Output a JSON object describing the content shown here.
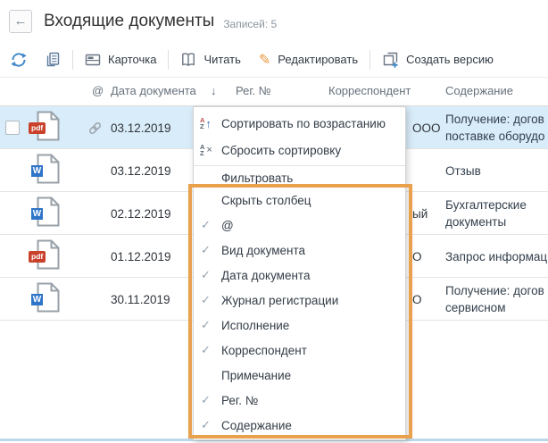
{
  "header": {
    "title": "Входящие документы",
    "records": "Записей: 5"
  },
  "icons": {
    "back": "←",
    "sort_arrow_down": "↓",
    "sort_arrow_up": "↑",
    "clear_x": "×",
    "check": "✓",
    "pencil": "✎",
    "az": {
      "a": "A",
      "z": "Z"
    }
  },
  "toolbar": {
    "card": "Карточка",
    "read": "Читать",
    "edit": "Редактировать",
    "create_version": "Создать версию"
  },
  "table": {
    "header": {
      "at": "@",
      "date": "Дата документа",
      "reg": "Рег. №",
      "correspondent": "Корреспондент",
      "content": "Содержание"
    },
    "rows": [
      {
        "badge": "pdf",
        "date": "03.12.2019",
        "correspondent_fragment": "ООО",
        "content": "Получение: догов\nпоставке оборудо"
      },
      {
        "badge": "W",
        "date": "03.12.2019",
        "correspondent_fragment": "",
        "content": "Отзыв"
      },
      {
        "badge": "W",
        "date": "02.12.2019",
        "correspondent_fragment": "ый",
        "content": "Бухгалтерские\nдокументы"
      },
      {
        "badge": "pdf",
        "date": "01.12.2019",
        "correspondent_fragment": "О",
        "content": "Запрос информац"
      },
      {
        "badge": "W",
        "date": "30.11.2019",
        "correspondent_fragment": "О",
        "content": "Получение: догов\nсервисном"
      }
    ]
  },
  "menu": {
    "sort_ascending": "Сортировать по возрастанию",
    "reset_sort": "Сбросить сортировку",
    "filter": "Фильтровать",
    "hide_column": "Скрыть столбец",
    "column_toggles": [
      {
        "check": "✓",
        "label": "@"
      },
      {
        "check": "✓",
        "label": "Вид документа"
      },
      {
        "check": "✓",
        "label": "Дата документа"
      },
      {
        "check": "✓",
        "label": "Журнал регистрации"
      },
      {
        "check": "✓",
        "label": "Исполнение"
      },
      {
        "check": "✓",
        "label": "Корреспондент"
      },
      {
        "check": "",
        "label": "Примечание"
      },
      {
        "check": "✓",
        "label": "Рег. №"
      },
      {
        "check": "✓",
        "label": "Содержание"
      }
    ]
  },
  "colors": {
    "selected_row": "#d9ecf9",
    "highlight_orange": "#e9a14d",
    "accent_blue": "#3f87c9",
    "edit_orange": "#e8973f",
    "pdf_red": "#c9412b",
    "word_blue": "#2e74c8"
  }
}
